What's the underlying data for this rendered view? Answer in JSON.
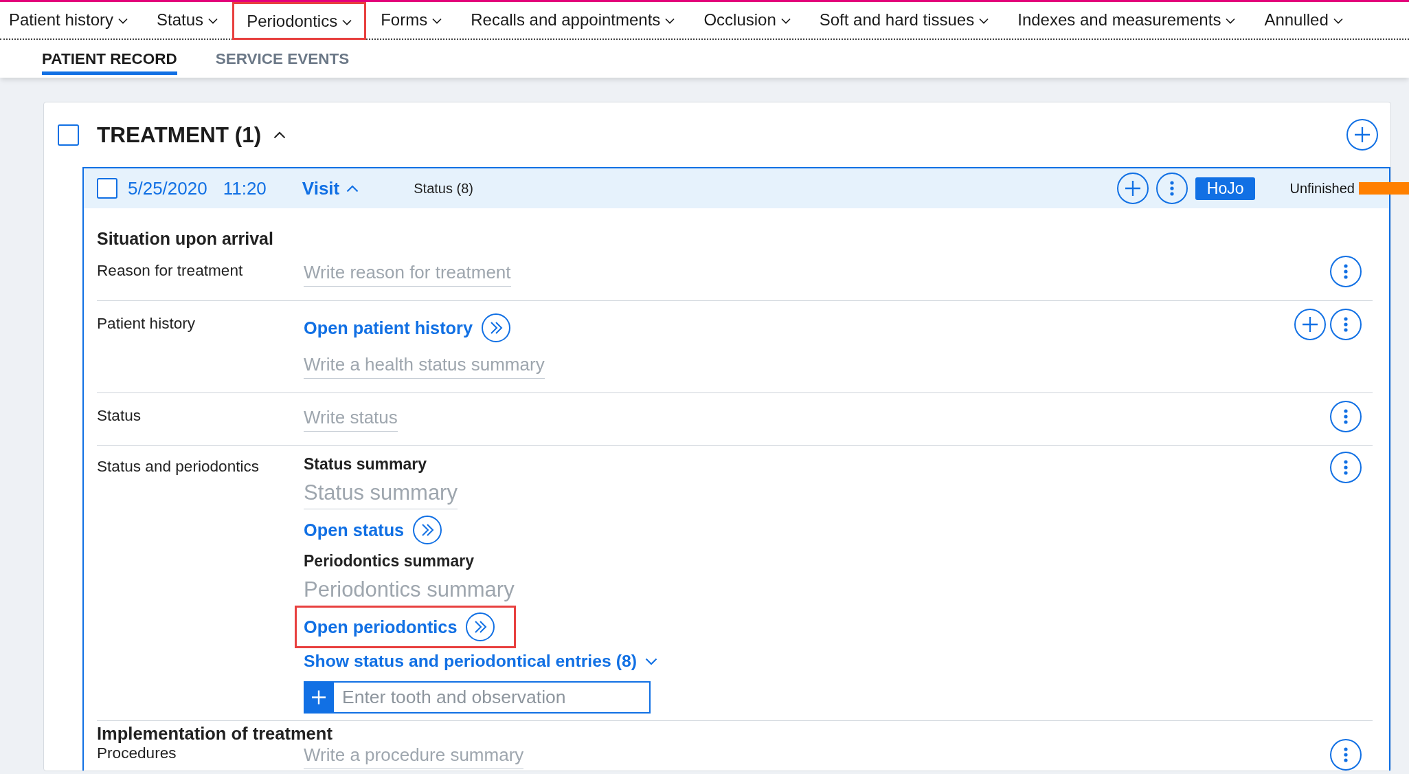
{
  "menu": [
    {
      "label": "Patient history",
      "highlighted": false
    },
    {
      "label": "Status",
      "highlighted": false
    },
    {
      "label": "Periodontics",
      "highlighted": true
    },
    {
      "label": "Forms",
      "highlighted": false
    },
    {
      "label": "Recalls and appointments",
      "highlighted": false
    },
    {
      "label": "Occlusion",
      "highlighted": false
    },
    {
      "label": "Soft and hard tissues",
      "highlighted": false
    },
    {
      "label": "Indexes and measurements",
      "highlighted": false
    },
    {
      "label": "Annulled",
      "highlighted": false
    }
  ],
  "tabs": [
    {
      "label": "PATIENT RECORD",
      "selected": true
    },
    {
      "label": "SERVICE EVENTS",
      "selected": false
    }
  ],
  "treatment": {
    "title": "TREATMENT (1)",
    "checked": false,
    "expanded": true
  },
  "visit": {
    "checked": false,
    "date": "5/25/2020",
    "time": "11:20",
    "type": "Visit",
    "expanded": true,
    "status": "Status (8)",
    "author": "HoJo",
    "state": "Unfinished",
    "groups": [
      {
        "heading": "Situation upon arrival",
        "rows": [
          {
            "label": "Reason for treatment",
            "content": [
              {
                "kind": "input",
                "placeholder": "Write reason for treatment"
              }
            ],
            "actions": [
              {
                "kind": "more"
              }
            ]
          },
          {
            "label": "Patient history",
            "content": [
              {
                "kind": "link",
                "text": "Open patient history",
                "highlighted": false
              },
              {
                "kind": "input",
                "placeholder": "Write a health status summary"
              }
            ],
            "actions": [
              {
                "kind": "add"
              },
              {
                "kind": "more"
              }
            ]
          },
          {
            "label": "Status",
            "content": [
              {
                "kind": "input",
                "placeholder": "Write status"
              }
            ],
            "actions": [
              {
                "kind": "more"
              }
            ]
          },
          {
            "label": "Status and periodontics",
            "content": [
              {
                "kind": "subheading",
                "text": "Status summary"
              },
              {
                "kind": "summary",
                "placeholder": "Status summary"
              },
              {
                "kind": "link",
                "text": "Open status",
                "highlighted": false
              },
              {
                "kind": "subheading",
                "text": "Periodontics summary"
              },
              {
                "kind": "summary",
                "placeholder": "Periodontics summary"
              },
              {
                "kind": "link",
                "text": "Open periodontics",
                "highlighted": true
              },
              {
                "kind": "toggle",
                "text": "Show status and periodontical entries (8)",
                "expanded": false
              },
              {
                "kind": "entry",
                "placeholder": "Enter tooth and observation"
              }
            ],
            "actions": [
              {
                "kind": "more"
              }
            ]
          }
        ]
      },
      {
        "heading": "Implementation of treatment",
        "rows": [
          {
            "label": "Procedures",
            "content": [
              {
                "kind": "input",
                "placeholder": "Write a procedure summary"
              }
            ],
            "actions": [
              {
                "kind": "more"
              }
            ]
          }
        ]
      }
    ]
  }
}
